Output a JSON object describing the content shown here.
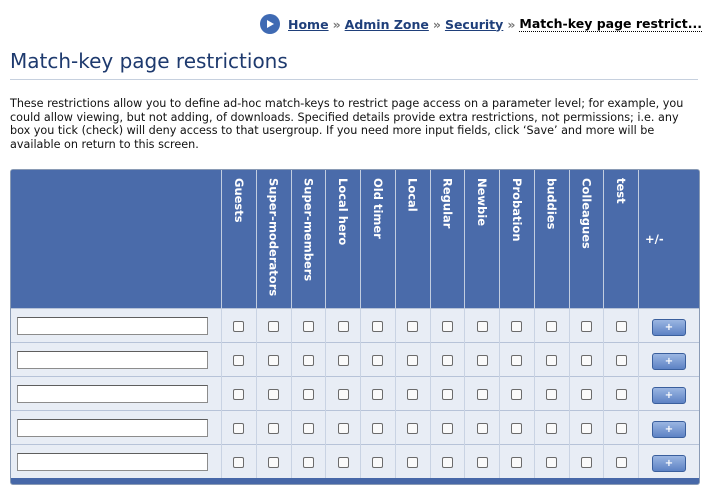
{
  "breadcrumb": {
    "items": [
      "Home",
      "Admin Zone",
      "Security"
    ],
    "separator": "»",
    "current": "Match-key page restrict..."
  },
  "page": {
    "title": "Match-key page restrictions",
    "intro": "These restrictions allow you to define ad-hoc match-keys to restrict page access on a parameter level; for example, you could allow viewing, but not adding, of downloads. Specified details provide extra restrictions, not permissions; i.e. any box you tick (check) will deny access to that usergroup. If you need more input fields, click ‘Save’ and more will be available on return to this screen."
  },
  "table": {
    "groups": [
      "Guests",
      "Super-moderators",
      "Super-members",
      "Local hero",
      "Old timer",
      "Local",
      "Regular",
      "Newbie",
      "Probation",
      "buddies",
      "Colleagues",
      "test"
    ],
    "action_header": "+/-",
    "rows": [
      {
        "match_key": "",
        "button": "+"
      },
      {
        "match_key": "",
        "button": "+"
      },
      {
        "match_key": "",
        "button": "+"
      },
      {
        "match_key": "",
        "button": "+"
      },
      {
        "match_key": "",
        "button": "+"
      }
    ]
  },
  "colors": {
    "header_bg": "#4a6baa",
    "row_bg": "#e8edf5",
    "title": "#1e3a6e",
    "link": "#1f3f7a"
  },
  "icons": {
    "breadcrumb": "play-circle-icon"
  }
}
